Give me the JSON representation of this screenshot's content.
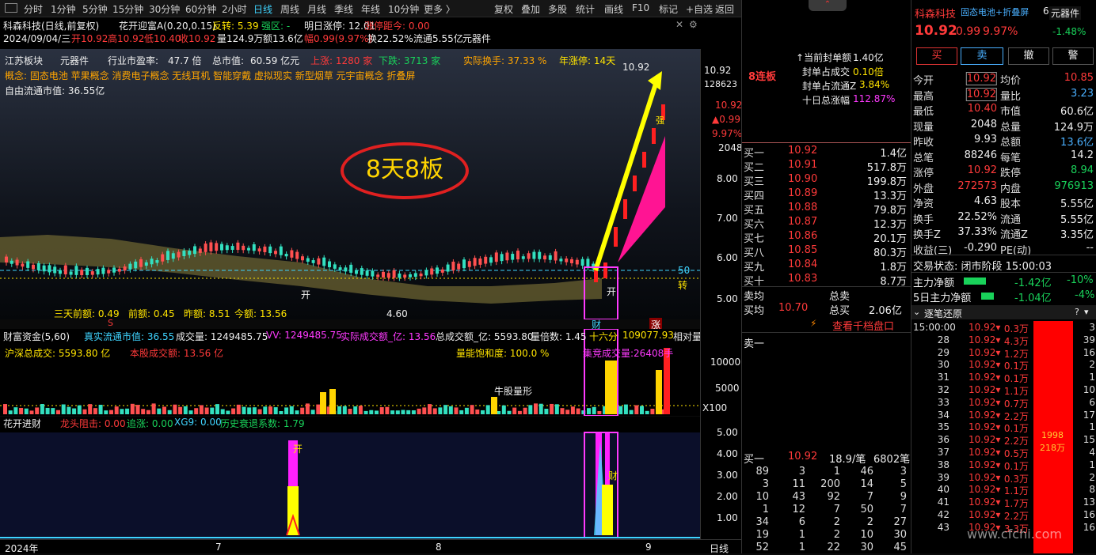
{
  "toolbar": {
    "items": [
      "分时",
      "1分钟",
      "5分钟",
      "15分钟",
      "30分钟",
      "60分钟",
      "2小时",
      "日线",
      "周线",
      "月线",
      "季线",
      "年线",
      "10分钟",
      "更多 〉"
    ],
    "right": [
      "复权",
      "叠加",
      "多股",
      "统计",
      "画线",
      "F10",
      "标记",
      "+自选",
      "返回"
    ]
  },
  "info": {
    "stock": "科森科技(日线,前复权)",
    "indicator": "花开迎富A(0.20,0.15)",
    "fanzhuan": "反转: 5.39",
    "qiangqu": "强区: -",
    "mingri": "明日涨停: 12.01",
    "juli": "涨停距今: 0.00",
    "date": "2024/09/04/三",
    "kai": "开10.92",
    "gao": "高10.92",
    "di": "低10.40",
    "shou": "收10.92",
    "liang": "量124.9万",
    "e": "额13.6亿",
    "fu": "幅0.99(9.97%)",
    "huan": "换22.52%",
    "liutong": "流通5.55亿",
    "bankuai": "元器件"
  },
  "main": {
    "row1": {
      "region": "江苏板块",
      "sector": "元器件",
      "pe_label": "行业市盈率:",
      "pe": "47.7 倍",
      "mv_label": "总市值:",
      "mv": "60.59 亿元",
      "up": "上涨: 1280 家",
      "down": "下跌: 3713 家",
      "turn": "实际换手: 37.33 %",
      "year": "年涨停: 14天"
    },
    "concepts": "概念:  固态电池  苹果概念 消费电子概念 无线耳机 智能穿戴 虚拟现实 新型烟草 元宇宙概念 折叠屏",
    "free": "自由流通市值:  36.55亿",
    "bubble": "8天8板",
    "bottom": {
      "a": "三天前额: 0.49",
      "b": "前额: 0.45",
      "c": "昨额: 8.51",
      "d": "今额: 13.56"
    },
    "labels": {
      "hi": "10.92",
      "kai1": "开",
      "kai2": "开",
      "lo": "4.60",
      "fifty": "50",
      "zhuan": "转",
      "cai": "财",
      "zhang": "涨",
      "S": "S",
      "zhan": "强"
    }
  },
  "yaxis": {
    "top": "10.92",
    "vol": "128623",
    "p1": "10.92",
    "p2": "▲0.99",
    "p3": "9.97%",
    "p4": "2048",
    "ticks": [
      "8.00",
      "7.00",
      "6.00",
      "5.00"
    ],
    "vticks": [
      "10000",
      "5000",
      "X100"
    ],
    "iticks": [
      "5.00",
      "4.00",
      "3.00",
      "2.00",
      "1.00"
    ]
  },
  "vol": {
    "title": "财富资金(5,60)",
    "liutong": "真实流通市值: 36.55",
    "cjl": "成交量: 1249485.75",
    "vv": "VV: 1249485.75",
    "sj": "实际成交额_亿: 13.56",
    "zcj": "总成交额_亿: 5593.80",
    "lb": "量倍数: 1.45",
    "slf": "十六分",
    "val": "109077.93",
    "xd": "相对量",
    "hs": "沪深总成交:  5593.80 亿",
    "bg": "本股成交额:  13.56 亿",
    "bh": "量能饱和度:  100.0 %",
    "jj": "集竞成交量:26408手",
    "nt": "牛股量形"
  },
  "ind": {
    "title": "花开进财",
    "lt": "龙头阻击: 0.00",
    "zz": "追涨: 0.00",
    "xg": "XG9: 0.00",
    "ls": "历史衰退系数: 1.79",
    "kai": "开",
    "cai": "财"
  },
  "xaxis": {
    "labels": [
      "2024年",
      "7",
      "8",
      "9"
    ],
    "mode": "日线"
  },
  "mid": {
    "lianban": "8连板",
    "fd": "当前封单额",
    "fd_v": "1.40亿",
    "fdcj": "封单占成交",
    "fdcj_v": "0.10倍",
    "fdlt": "封单占流通Z",
    "fdlt_v": "3.84%",
    "sr": "十日总涨幅",
    "sr_v": "112.87%",
    "buy": [
      [
        "买一",
        "10.92",
        "1.4亿"
      ],
      [
        "买二",
        "10.91",
        "517.8万"
      ],
      [
        "买三",
        "10.90",
        "199.8万"
      ],
      [
        "买四",
        "10.89",
        "13.3万"
      ],
      [
        "买五",
        "10.88",
        "79.8万"
      ],
      [
        "买六",
        "10.87",
        "12.3万"
      ],
      [
        "买七",
        "10.86",
        "20.1万"
      ],
      [
        "买八",
        "10.85",
        "80.3万"
      ],
      [
        "买九",
        "10.84",
        "1.8万"
      ],
      [
        "买十",
        "10.83",
        "8.7万"
      ]
    ],
    "maijun": "卖均",
    "zongmai": "总卖",
    "maijun2": "买均",
    "mj_v": "10.70",
    "zongmai2": "总买",
    "zm_v": "2.06亿",
    "qd": "查看千档盘口",
    "mai1": "卖一",
    "b1": [
      "买一",
      "10.92",
      "18.9/笔",
      "6802笔"
    ],
    "grid": [
      [
        "89",
        "3",
        "1",
        "46",
        "3"
      ],
      [
        "3",
        "11",
        "200",
        "14",
        "5"
      ],
      [
        "10",
        "43",
        "92",
        "7",
        "9"
      ],
      [
        "1",
        "12",
        "7",
        "50",
        "7"
      ],
      [
        "34",
        "6",
        "2",
        "2",
        "27"
      ],
      [
        "19",
        "1",
        "2",
        "10",
        "30"
      ],
      [
        "52",
        "1",
        "22",
        "30",
        "45"
      ]
    ]
  },
  "right": {
    "name": "科森科技",
    "tags": "固态电池+折叠屏",
    "code": "603626",
    "sector": "元器件",
    "pct": "-1.48%",
    "price": "10.92",
    "chg": "0.99",
    "chgp": "9.97%",
    "btns": [
      "买",
      "卖",
      "撤",
      "警"
    ],
    "stats": [
      [
        "今开",
        "10.92",
        "均价",
        "10.85"
      ],
      [
        "最高",
        "10.92",
        "量比",
        "3.23"
      ],
      [
        "最低",
        "10.40",
        "市值",
        "60.6亿"
      ],
      [
        "现量",
        "2048",
        "总量",
        "124.9万"
      ],
      [
        "昨收",
        "9.93",
        "总额",
        "13.6亿"
      ],
      [
        "总笔",
        "88246",
        "每笔",
        "14.2"
      ],
      [
        "涨停",
        "10.92",
        "跌停",
        "8.94"
      ],
      [
        "外盘",
        "272573",
        "内盘",
        "976913"
      ],
      [
        "净资",
        "4.63",
        "股本",
        "5.55亿"
      ],
      [
        "换手",
        "22.52%",
        "流通",
        "5.55亿"
      ],
      [
        "换手Z",
        "37.33%",
        "流通Z",
        "3.35亿"
      ],
      [
        "收益(三)",
        "-0.290",
        "PE(动)",
        "--"
      ]
    ],
    "status": "交易状态: 闭市阶段 15:00:03",
    "zl": "主力净额",
    "zl_v": "-1.42亿",
    "zl_p": "-10%",
    "wr": "5日主力净额",
    "wr_v": "-1.04亿",
    "wr_p": "-4%",
    "ticks_title": "逐笔还原",
    "ticks": [
      [
        "15:00:00",
        "10.92",
        "0.3万",
        "3"
      ],
      [
        "28",
        "10.92",
        "4.3万",
        "39"
      ],
      [
        "29",
        "10.92",
        "1.2万",
        "16"
      ],
      [
        "30",
        "10.92",
        "0.1万",
        "2"
      ],
      [
        "31",
        "10.92",
        "0.1万",
        "1"
      ],
      [
        "32",
        "10.92",
        "1.1万",
        "10"
      ],
      [
        "33",
        "10.92",
        "0.7万",
        "6"
      ],
      [
        "34",
        "10.92",
        "2.2万",
        "17"
      ],
      [
        "35",
        "10.92",
        "0.1万",
        "1"
      ],
      [
        "36",
        "10.92",
        "2.2万",
        "15"
      ],
      [
        "37",
        "10.92",
        "0.5万",
        "4"
      ],
      [
        "38",
        "10.92",
        "0.1万",
        "1"
      ],
      [
        "39",
        "10.92",
        "0.3万",
        "2"
      ],
      [
        "40",
        "10.92",
        "1.1万",
        "8"
      ],
      [
        "41",
        "10.92",
        "1.7万",
        "13"
      ],
      [
        "42",
        "10.92",
        "2.2万",
        "16"
      ],
      [
        "43",
        "10.92",
        "3.3万",
        "16"
      ]
    ],
    "bigbar": "1998",
    "bigbar2": "218万",
    "watermark": "www.cfchi.com"
  }
}
